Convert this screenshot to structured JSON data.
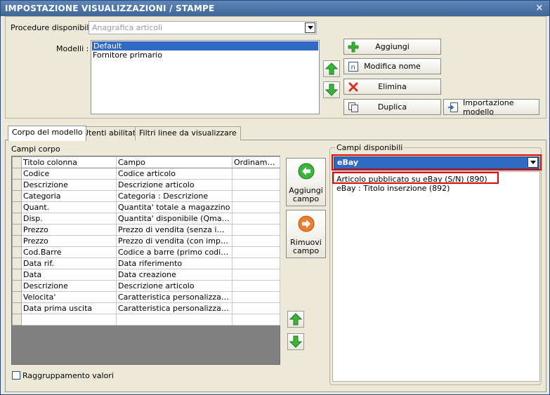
{
  "window": {
    "title": "IMPOSTAZIONE VISUALIZZAZIONI / STAMPE",
    "close_glyph": "×"
  },
  "top": {
    "procedure_label": "Procedure disponibili :",
    "procedure_value": "Anagrafica articoli",
    "models_label": "Modelli :",
    "models": [
      "Default",
      "Fornitore primario"
    ],
    "selected_model": "Default",
    "buttons": {
      "add": "Aggiungi",
      "rename": "Modifica nome",
      "delete": "Elimina",
      "duplicate": "Duplica",
      "import": "Importazione modello"
    }
  },
  "tabs": [
    "Corpo del modello",
    "Utenti abilitati",
    "Filtri linee da visualizzare"
  ],
  "body": {
    "grid_label": "Campi corpo",
    "columns": [
      "Titolo colonna",
      "Campo",
      "Ordiname..."
    ],
    "rows": [
      [
        "Codice",
        "Codice articolo",
        ""
      ],
      [
        "Descrizione",
        "Descrizione articolo",
        ""
      ],
      [
        "Categoria",
        "Categoria : Descrizione",
        ""
      ],
      [
        "Quant.",
        "Quantita' totale a magazzino",
        ""
      ],
      [
        "Disp.",
        "Quantita' disponibile (Qmag-Qo...",
        ""
      ],
      [
        "Prezzo",
        "Prezzo di vendita (senza imposte)",
        ""
      ],
      [
        "Prezzo",
        "Prezzo di vendita (con imposte)",
        ""
      ],
      [
        "Cod.Barre",
        "Codice a barre (primo codice a ...",
        ""
      ],
      [
        "Data rif.",
        "Data riferimento",
        ""
      ],
      [
        "Data",
        "Data creazione",
        ""
      ],
      [
        "Descrizione",
        "Descrizione articolo",
        ""
      ],
      [
        "Velocita'",
        "Caratteristica personalizzata (s...",
        ""
      ],
      [
        "Data prima uscita",
        "Caratteristica personalizzata (s...",
        ""
      ]
    ],
    "add_field": [
      "Aggiungi",
      "campo"
    ],
    "remove_field": [
      "Rimuovi",
      "campo"
    ],
    "available_label": "Campi disponibili",
    "available_category": "eBay",
    "available_fields": [
      "Articolo pubblicato su eBay (S/N) (890)",
      "eBay : Titolo inserzione (892)"
    ],
    "group_values_label": "Raggruppamento valori"
  },
  "colors": {
    "title": "#3d6596",
    "highlight": "#e00000",
    "selection": "#316ac5"
  }
}
